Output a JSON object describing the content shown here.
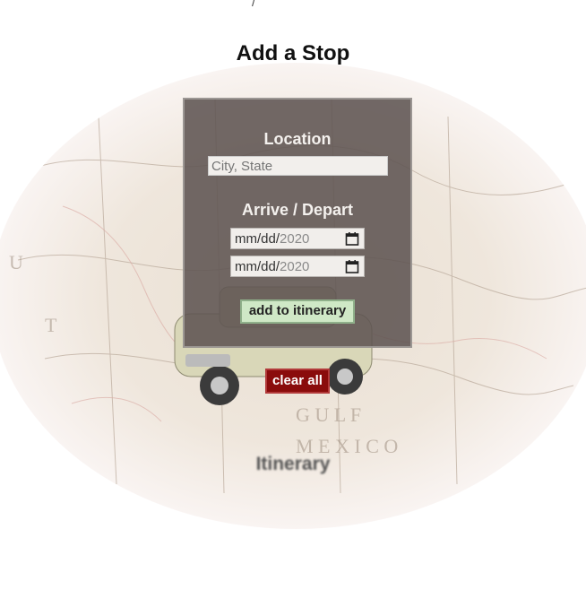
{
  "page": {
    "title": "Add a Stop",
    "top_mark": "/"
  },
  "form": {
    "location_label": "Location",
    "location_placeholder": "City, State",
    "location_value": "",
    "dates_label": "Arrive / Depart",
    "arrive": {
      "mmdd": "mm/dd/",
      "year": "2020"
    },
    "depart": {
      "mmdd": "mm/dd/",
      "year": "2020"
    },
    "add_button": "add to itinerary"
  },
  "actions": {
    "clear_button": "clear all"
  },
  "itinerary": {
    "heading": "Itinerary"
  },
  "colors": {
    "panel": "#5f5452",
    "add_button": "#cfe8c6",
    "clear_button": "#8a0c0c"
  },
  "icons": {
    "date_picker": "calendar-icon"
  }
}
